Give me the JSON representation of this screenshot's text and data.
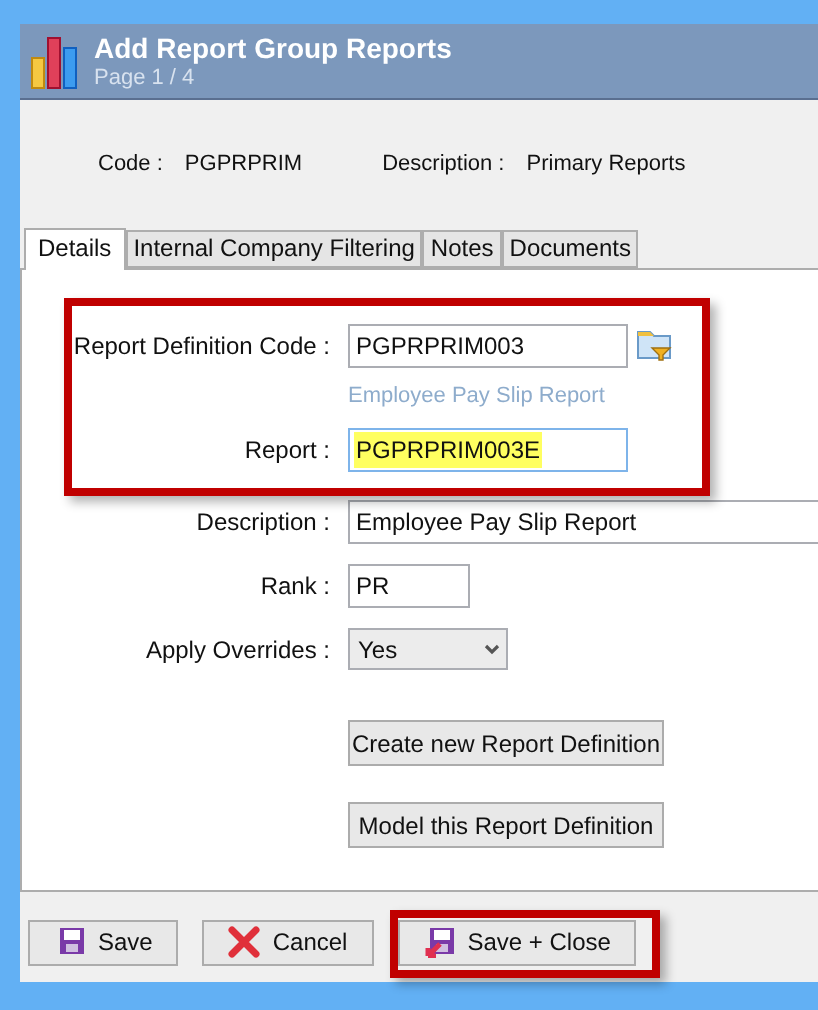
{
  "window": {
    "title": "Add Report Group Reports",
    "subtitle": "Page 1 / 4"
  },
  "header_fields": [
    {
      "label": "Code :",
      "value": "PGPRPRIM"
    },
    {
      "label": "Description :",
      "value": "Primary Reports"
    }
  ],
  "tabs": [
    {
      "label": "Details",
      "selected": true
    },
    {
      "label": "Internal Company Filtering",
      "selected": false
    },
    {
      "label": "Notes",
      "selected": false
    },
    {
      "label": "Documents",
      "selected": false
    }
  ],
  "fields": [
    {
      "kind": "lookup",
      "label": "Report Definition Code :",
      "value": "PGPRPRIM003",
      "hint": "Employee Pay Slip Report",
      "highlighted": true,
      "focused": false,
      "text_selected": false
    },
    {
      "kind": "text",
      "label": "Report :",
      "value": "PGPRPRIM003E",
      "highlighted": true,
      "focused": true,
      "text_selected": true
    },
    {
      "kind": "wide_text",
      "label": "Description :",
      "value": "Employee Pay Slip Report",
      "highlighted": false,
      "focused": false,
      "text_selected": false
    },
    {
      "kind": "short_text",
      "label": "Rank :",
      "value": "PR",
      "highlighted": false,
      "focused": false,
      "text_selected": false
    },
    {
      "kind": "select",
      "label": "Apply Overrides :",
      "value": "Yes",
      "highlighted": false,
      "focused": false,
      "text_selected": false
    }
  ],
  "actions": [
    "Create new Report Definition",
    "Model this Report Definition"
  ],
  "footer_buttons": [
    {
      "kind": "save",
      "label": "Save",
      "highlighted": false
    },
    {
      "kind": "cancel",
      "label": "Cancel",
      "highlighted": false
    },
    {
      "kind": "save_close",
      "label": "Save + Close",
      "highlighted": true
    }
  ]
}
